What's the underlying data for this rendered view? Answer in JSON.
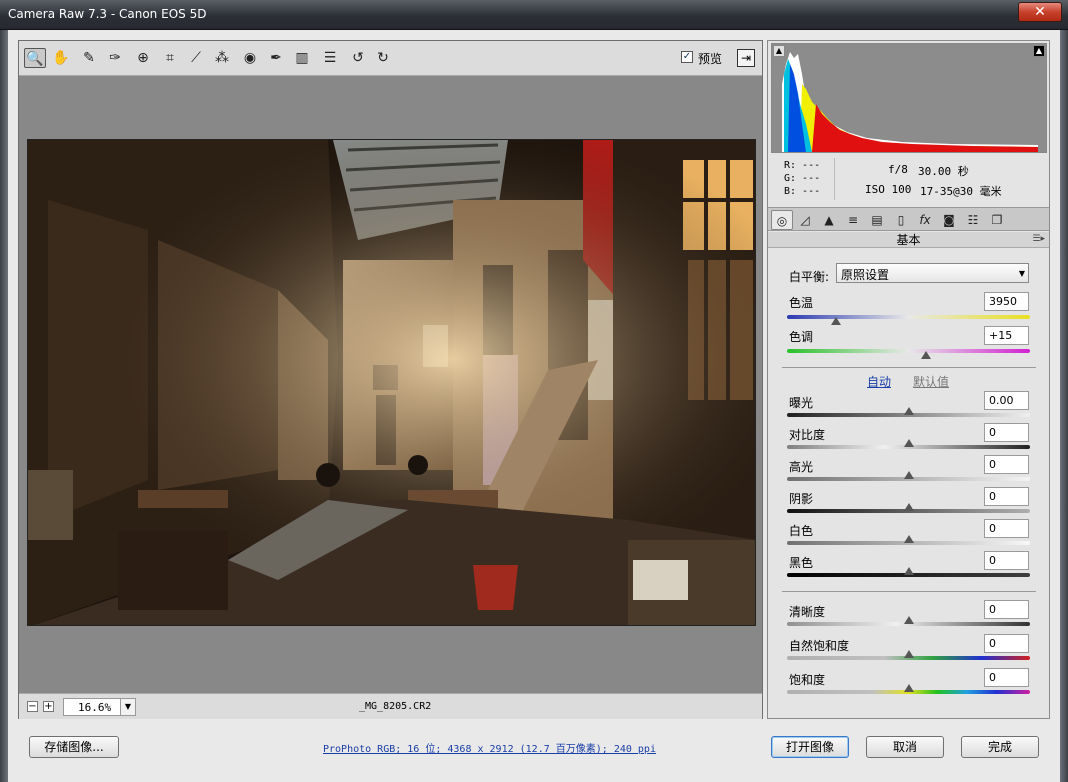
{
  "window": {
    "title": "Camera Raw 7.3 -  Canon EOS 5D",
    "close_glyph": "✕"
  },
  "toolbar": {
    "tools": [
      {
        "name": "zoom-tool-icon",
        "glyph": "🔍"
      },
      {
        "name": "hand-tool-icon",
        "glyph": "✋"
      },
      {
        "name": "white-balance-tool-icon",
        "glyph": "✎"
      },
      {
        "name": "color-sampler-tool-icon",
        "glyph": "✑"
      },
      {
        "name": "targeted-adjustment-tool-icon",
        "glyph": "⊕"
      },
      {
        "name": "crop-tool-icon",
        "glyph": "⌗"
      },
      {
        "name": "straighten-tool-icon",
        "glyph": "⟋"
      },
      {
        "name": "spot-removal-tool-icon",
        "glyph": "⁂"
      },
      {
        "name": "red-eye-tool-icon",
        "glyph": "◉"
      },
      {
        "name": "adjustment-brush-icon",
        "glyph": "✒"
      },
      {
        "name": "graduated-filter-icon",
        "glyph": "▥"
      },
      {
        "name": "preferences-icon",
        "glyph": "☰"
      },
      {
        "name": "rotate-ccw-icon",
        "glyph": "↺"
      },
      {
        "name": "rotate-cw-icon",
        "glyph": "↻"
      }
    ],
    "preview_checked": "✓",
    "preview_label": "预览",
    "exit_glyph": "⇥"
  },
  "zoom": {
    "minus": "−",
    "plus": "+",
    "value": "16.6%",
    "dropdown": "▼"
  },
  "file_name": "_MG_8205.CR2",
  "histogram": {
    "clip_shadow": "▲",
    "clip_highlight": "▲"
  },
  "readout": {
    "r": "R:  ---",
    "g": "G:  ---",
    "b": "B:  ---",
    "aperture": "f/8",
    "shutter": "30.00 秒",
    "iso": "ISO 100",
    "lens": "17-35@30 毫米"
  },
  "panel_tabs": [
    {
      "name": "tab-basic-icon",
      "glyph": "◎"
    },
    {
      "name": "tab-tone-curve-icon",
      "glyph": "◿"
    },
    {
      "name": "tab-detail-icon",
      "glyph": "▲"
    },
    {
      "name": "tab-hsl-icon",
      "glyph": "≡"
    },
    {
      "name": "tab-split-toning-icon",
      "glyph": "▤"
    },
    {
      "name": "tab-lens-corrections-icon",
      "glyph": "▯"
    },
    {
      "name": "tab-effects-icon",
      "glyph": "fx"
    },
    {
      "name": "tab-camera-calibration-icon",
      "glyph": "◙"
    },
    {
      "name": "tab-presets-icon",
      "glyph": "☷"
    },
    {
      "name": "tab-snapshots-icon",
      "glyph": "❐"
    }
  ],
  "section": {
    "title": "基本",
    "menu_glyph": "☰▸"
  },
  "white_balance": {
    "label": "白平衡:",
    "value": "原照设置",
    "arrow": "▼"
  },
  "controls": [
    {
      "key": "temperature",
      "label": "色温",
      "value": "3950",
      "level": 0.2
    },
    {
      "key": "tint",
      "label": "色调",
      "value": "+15",
      "level": 0.57
    },
    {
      "key": "exposure",
      "label": "曝光",
      "value": "0.00",
      "level": 0.5
    },
    {
      "key": "contrast",
      "label": "对比度",
      "value": "0",
      "level": 0.5
    },
    {
      "key": "highlights",
      "label": "高光",
      "value": "0",
      "level": 0.5
    },
    {
      "key": "shadows",
      "label": "阴影",
      "value": "0",
      "level": 0.5
    },
    {
      "key": "whites",
      "label": "白色",
      "value": "0",
      "level": 0.5
    },
    {
      "key": "blacks",
      "label": "黑色",
      "value": "0",
      "level": 0.5
    },
    {
      "key": "clarity",
      "label": "清晰度",
      "value": "0",
      "level": 0.5
    },
    {
      "key": "vibrance",
      "label": "自然饱和度",
      "value": "0",
      "level": 0.5
    },
    {
      "key": "saturation",
      "label": "饱和度",
      "value": "0",
      "level": 0.5
    }
  ],
  "auto_label": "自动",
  "default_label": "默认值",
  "footer": {
    "save_label": "存储图像...",
    "workflow_label": "ProPhoto RGB; 16 位; 4368 x 2912 (12.7 百万像素); 240 ppi",
    "open_label": "打开图像",
    "cancel_label": "取消",
    "done_label": "完成"
  },
  "colors": {
    "accent": "#3a77c4",
    "link": "#1a3fa6"
  }
}
